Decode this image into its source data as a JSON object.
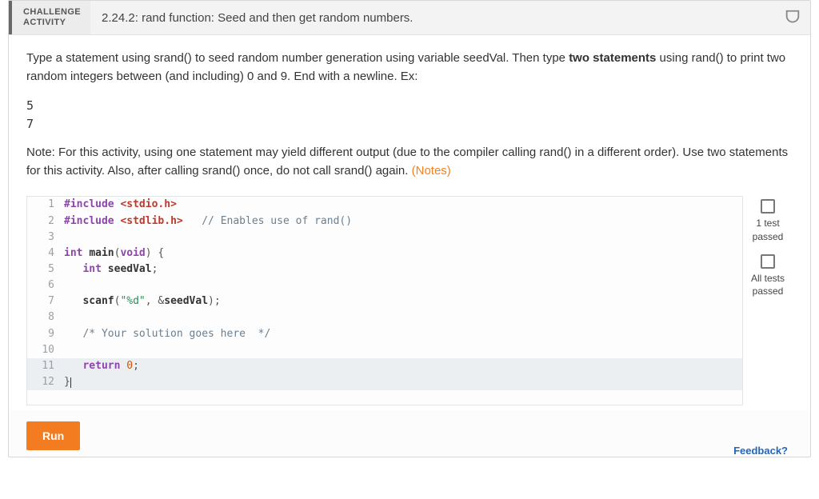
{
  "header": {
    "badge_line1": "CHALLENGE",
    "badge_line2": "ACTIVITY",
    "title": "2.24.2: rand function: Seed and then get random numbers."
  },
  "instructions": {
    "part1": "Type a statement using srand() to seed random number generation using variable seedVal. Then type ",
    "bold": "two statements",
    "part2": " using rand() to print two random integers between (and including) 0 and 9. End with a newline. Ex:"
  },
  "example": {
    "line1": "5",
    "line2": "7"
  },
  "note": {
    "text": "Note: For this activity, using one statement may yield different output (due to the compiler calling rand() in a different order). Use two statements for this activity. Also, after calling srand() once, do not call srand() again. ",
    "link": "(Notes)"
  },
  "status": {
    "one_test_label1": "1 test",
    "one_test_label2": "passed",
    "all_tests_label1": "All tests",
    "all_tests_label2": "passed"
  },
  "code": {
    "lines": [
      {
        "n": "1",
        "hl": false,
        "segs": [
          [
            "prep",
            "#include "
          ],
          [
            "hdr",
            "<stdio.h>"
          ]
        ]
      },
      {
        "n": "2",
        "hl": false,
        "segs": [
          [
            "prep",
            "#include "
          ],
          [
            "hdr",
            "<stdlib.h>"
          ],
          [
            "punc",
            "   "
          ],
          [
            "com",
            "// Enables use of rand()"
          ]
        ]
      },
      {
        "n": "3",
        "hl": false,
        "segs": []
      },
      {
        "n": "4",
        "hl": false,
        "segs": [
          [
            "type",
            "int"
          ],
          [
            "punc",
            " "
          ],
          [
            "id",
            "main"
          ],
          [
            "punc",
            "("
          ],
          [
            "type",
            "void"
          ],
          [
            "punc",
            ") {"
          ]
        ]
      },
      {
        "n": "5",
        "hl": false,
        "segs": [
          [
            "punc",
            "   "
          ],
          [
            "type",
            "int"
          ],
          [
            "punc",
            " "
          ],
          [
            "id",
            "seedVal"
          ],
          [
            "punc",
            ";"
          ]
        ]
      },
      {
        "n": "6",
        "hl": false,
        "segs": []
      },
      {
        "n": "7",
        "hl": false,
        "segs": [
          [
            "punc",
            "   "
          ],
          [
            "id",
            "scanf"
          ],
          [
            "punc",
            "("
          ],
          [
            "str",
            "\"%d\""
          ],
          [
            "punc",
            ", &"
          ],
          [
            "id",
            "seedVal"
          ],
          [
            "punc",
            ");"
          ]
        ]
      },
      {
        "n": "8",
        "hl": false,
        "segs": []
      },
      {
        "n": "9",
        "hl": false,
        "segs": [
          [
            "punc",
            "   "
          ],
          [
            "com",
            "/* Your solution goes here  */"
          ]
        ]
      },
      {
        "n": "10",
        "hl": false,
        "segs": []
      },
      {
        "n": "11",
        "hl": true,
        "segs": [
          [
            "punc",
            "   "
          ],
          [
            "kw",
            "return"
          ],
          [
            "punc",
            " "
          ],
          [
            "num",
            "0"
          ],
          [
            "punc",
            ";"
          ]
        ]
      },
      {
        "n": "12",
        "hl": true,
        "segs": [
          [
            "punc",
            "}"
          ]
        ],
        "caret": true
      }
    ]
  },
  "run_button": "Run",
  "feedback": "Feedback?"
}
